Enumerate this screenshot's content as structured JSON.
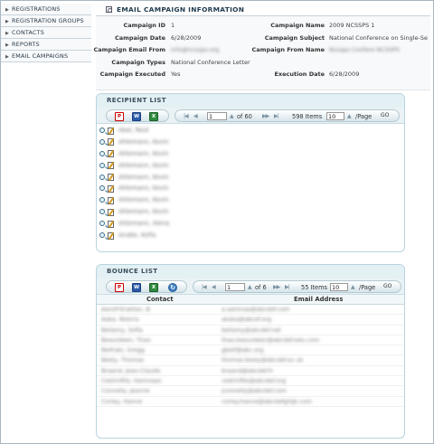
{
  "sidebar": {
    "items": [
      {
        "label": "REGISTRATIONS"
      },
      {
        "label": "REGISTRATION GROUPS"
      },
      {
        "label": "CONTACTS"
      },
      {
        "label": "REPORTS"
      },
      {
        "label": "EMAIL CAMPAIGNS"
      }
    ]
  },
  "campaign": {
    "title": "EMAIL CAMPAIGN INFORMATION",
    "labels": {
      "id": "Campaign ID",
      "date": "Campaign Date",
      "email_from": "Campaign Email From",
      "types": "Campaign Types",
      "executed": "Campaign Executed",
      "name": "Campaign Name",
      "subject": "Campaign Subject",
      "from_name": "Campaign From Name",
      "execution_date": "Execution Date"
    },
    "values": {
      "id": "1",
      "date": "6/28/2009",
      "email_from": "info@ncssps.org",
      "types": "National Conference Letter",
      "executed": "Yes",
      "name": "2009 NCSSPS 1",
      "subject": "National Conference on Single-Se",
      "from_name": "Ncssps Confere NCSSPS",
      "execution_date": "6/28/2009"
    }
  },
  "recipient_list": {
    "title": "RECIPIENT LIST",
    "pager": {
      "page": "1",
      "of_pages": "of 60",
      "items": "598 Items",
      "page_size": "10",
      "per_page": "/Page",
      "go": "GO"
    },
    "rows": [
      "Abel, Reid",
      "Ahlemann, Kevin",
      "Ahlemann, Kevin",
      "Ahlemann, Kevin",
      "Ahlemann, Kevin",
      "Ahlemann, Kevin",
      "Ahlemann, Kevin",
      "Ahlemann, Kevin",
      "Ahlemann, Alena",
      "Anabe, Kofia"
    ]
  },
  "bounce_list": {
    "title": "BOUNCE LIST",
    "pager": {
      "page": "1",
      "of_pages": "of 6",
      "items": "55 Items",
      "page_size": "10",
      "per_page": "/Page",
      "go": "GO"
    },
    "columns": [
      "Contact",
      "Email Address"
    ],
    "rows": [
      {
        "contact": "Aarolf-Kraktan, B",
        "email": "a.aaronaa@abcdef.com"
      },
      {
        "contact": "Aaka, Noerra",
        "email": "akaka@abcef.org"
      },
      {
        "contact": "Bellamy, Sofia",
        "email": "bellamy@abcdef.net"
      },
      {
        "contact": "Beaurdeen, Thao",
        "email": "thao.beaurdeen@abcdef.edu.com"
      },
      {
        "contact": "Belfraki, Gregg",
        "email": "gbelf@abc.org"
      },
      {
        "contact": "Beely, Thomas",
        "email": "thomas.beely@abcdef.ac.uk"
      },
      {
        "contact": "Braand, Jean-Claude",
        "email": "braand@abcdef.fr"
      },
      {
        "contact": "Cedrinfilis, Hamnaan",
        "email": "cedrinfilis@abcdef.org"
      },
      {
        "contact": "Connelly, Jeanne",
        "email": "jconnelly@abcdef.com"
      },
      {
        "contact": "Corley, Hanne",
        "email": "corley.hanne@abcdefghijk.com"
      }
    ]
  }
}
